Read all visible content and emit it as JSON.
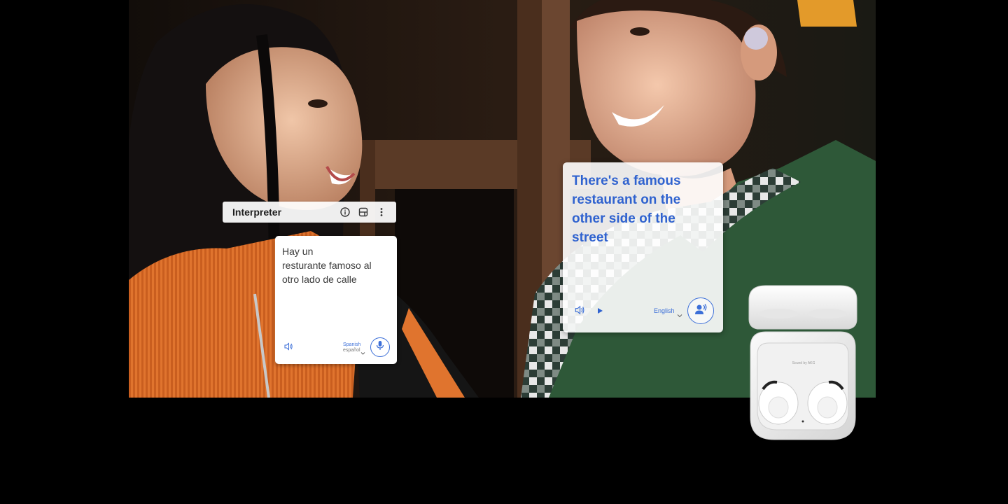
{
  "interpreter": {
    "title": "Interpreter",
    "icons": [
      "info-icon",
      "split-view-icon",
      "more-vert-icon"
    ]
  },
  "source_card": {
    "lines": [
      "Hay un",
      "resturante famoso al",
      "otro lado de calle"
    ],
    "language": "Spanish",
    "language_native": "español",
    "speaker_icon": "speaker-icon",
    "mic_icon": "mic-icon"
  },
  "translation_card": {
    "lines": [
      "There's a famous",
      "restaurant on the",
      "other side of the",
      "street"
    ],
    "language": "English",
    "speaker_icon": "speaker-icon",
    "play_icon": "play-icon",
    "conversation_icon": "conversation-icon"
  },
  "product": {
    "case_text": "Sound by AKG"
  },
  "colors": {
    "accent": "#2f62cf",
    "background": "#000000"
  }
}
